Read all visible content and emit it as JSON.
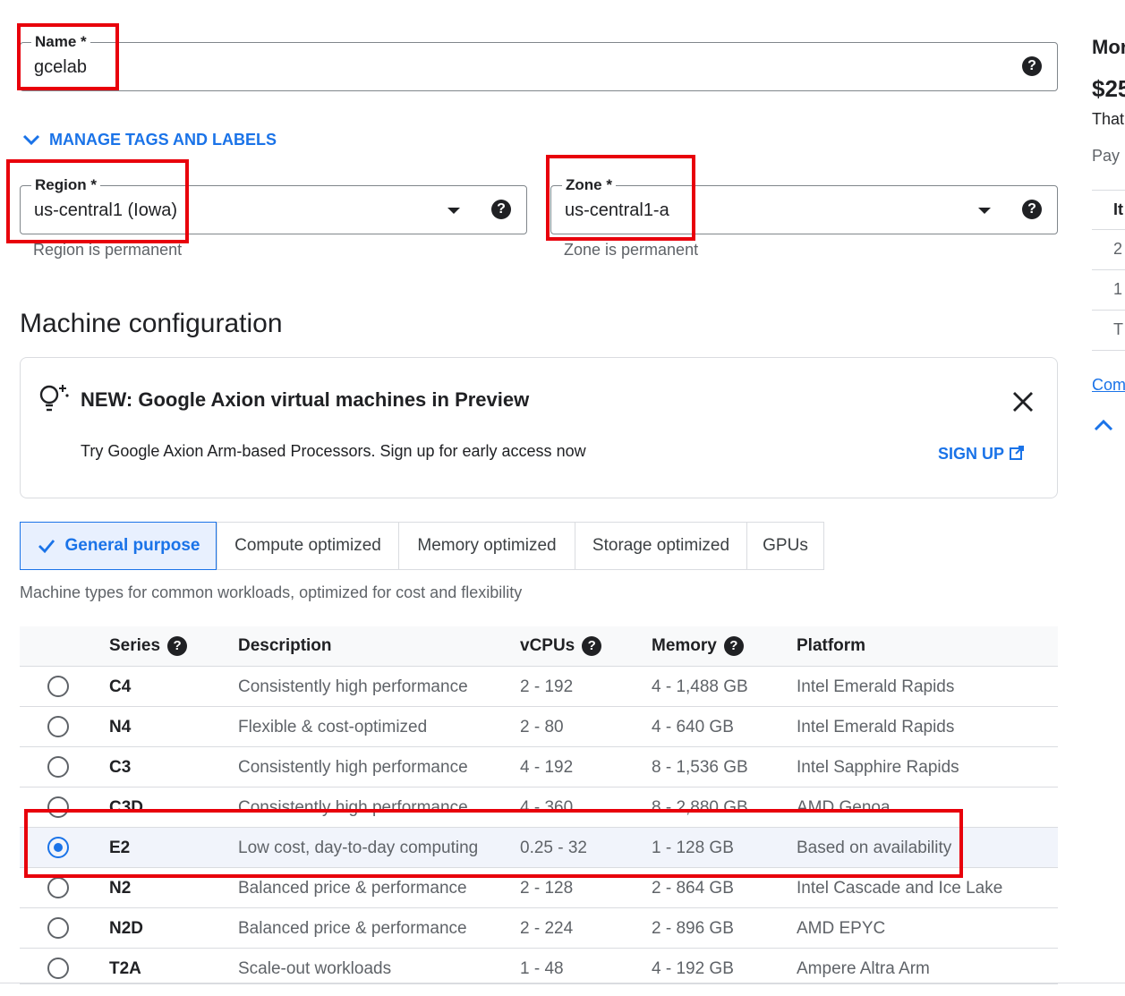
{
  "form": {
    "name": {
      "label": "Name *",
      "value": "gcelab"
    },
    "manage_tags_label": "MANAGE TAGS AND LABELS",
    "region": {
      "label": "Region *",
      "value": "us-central1 (Iowa)",
      "hint": "Region is permanent"
    },
    "zone": {
      "label": "Zone *",
      "value": "us-central1-a",
      "hint": "Zone is permanent"
    }
  },
  "machine_config": {
    "heading": "Machine configuration",
    "banner": {
      "title": "NEW: Google Axion virtual machines in Preview",
      "body": "Try Google Axion Arm-based Processors. Sign up for early access now",
      "signup_label": "SIGN UP"
    },
    "tabs": [
      {
        "label": "General purpose",
        "active": true
      },
      {
        "label": "Compute optimized"
      },
      {
        "label": "Memory optimized"
      },
      {
        "label": "Storage optimized"
      },
      {
        "label": "GPUs"
      }
    ],
    "tab_description": "Machine types for common workloads, optimized for cost and flexibility",
    "table": {
      "headers": {
        "series": "Series",
        "description": "Description",
        "vcpus": "vCPUs",
        "memory": "Memory",
        "platform": "Platform"
      },
      "rows": [
        {
          "series": "C4",
          "description": "Consistently high performance",
          "vcpus": "2 - 192",
          "memory": "4 - 1,488 GB",
          "platform": "Intel Emerald Rapids"
        },
        {
          "series": "N4",
          "description": "Flexible & cost-optimized",
          "vcpus": "2 - 80",
          "memory": "4 - 640 GB",
          "platform": "Intel Emerald Rapids"
        },
        {
          "series": "C3",
          "description": "Consistently high performance",
          "vcpus": "4 - 192",
          "memory": "8 - 1,536 GB",
          "platform": "Intel Sapphire Rapids"
        },
        {
          "series": "C3D",
          "description": "Consistently high performance",
          "vcpus": "4 - 360",
          "memory": "8 - 2,880 GB",
          "platform": "AMD Genoa"
        },
        {
          "series": "E2",
          "description": "Low cost, day-to-day computing",
          "vcpus": "0.25 - 32",
          "memory": "1 - 128 GB",
          "platform": "Based on availability",
          "selected": true
        },
        {
          "series": "N2",
          "description": "Balanced price & performance",
          "vcpus": "2 - 128",
          "memory": "2 - 864 GB",
          "platform": "Intel Cascade and Ice Lake"
        },
        {
          "series": "N2D",
          "description": "Balanced price & performance",
          "vcpus": "2 - 224",
          "memory": "2 - 896 GB",
          "platform": "AMD EPYC"
        },
        {
          "series": "T2A",
          "description": "Scale-out workloads",
          "vcpus": "1 - 48",
          "memory": "4 - 192 GB",
          "platform": "Ampere Altra Arm"
        }
      ]
    }
  },
  "right_panel": {
    "title": "Mor",
    "price": "$25",
    "subtitle": "That",
    "pay": "Pay",
    "table_header": "It",
    "rows": [
      "2",
      "1",
      "T"
    ],
    "link": "Com"
  },
  "colors": {
    "accent": "#1a73e8",
    "highlight_box": "#e8000b"
  }
}
